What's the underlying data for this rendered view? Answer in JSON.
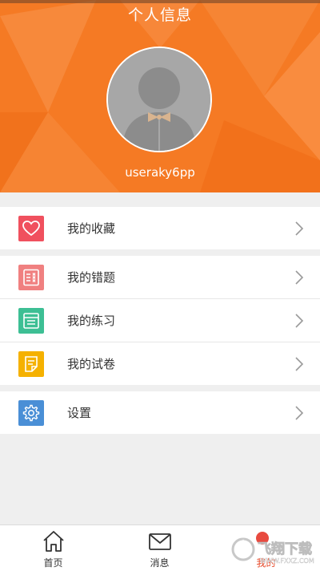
{
  "header": {
    "title": "个人信息",
    "username": "useraky6pp"
  },
  "menu": {
    "groups": [
      {
        "items": [
          {
            "label": "我的收藏",
            "icon": "heart-icon",
            "color": "#f0505e"
          }
        ]
      },
      {
        "items": [
          {
            "label": "我的错题",
            "icon": "wrong-list-icon",
            "color": "#f08080"
          },
          {
            "label": "我的练习",
            "icon": "practice-icon",
            "color": "#3dbf94"
          },
          {
            "label": "我的试卷",
            "icon": "paper-icon",
            "color": "#f5b100"
          }
        ]
      },
      {
        "items": [
          {
            "label": "设置",
            "icon": "gear-icon",
            "color": "#4a8fd6"
          }
        ]
      }
    ]
  },
  "tabbar": {
    "tabs": [
      {
        "label": "首页",
        "icon": "home-icon"
      },
      {
        "label": "消息",
        "icon": "mail-icon"
      },
      {
        "label": "我的",
        "icon": "profile-icon",
        "active": true
      }
    ]
  },
  "watermark": {
    "text": "飞翔下载",
    "subtext": "WWW.FXXZ.COM"
  },
  "colors": {
    "header": "#f57a24",
    "active": "#e74b2b"
  }
}
